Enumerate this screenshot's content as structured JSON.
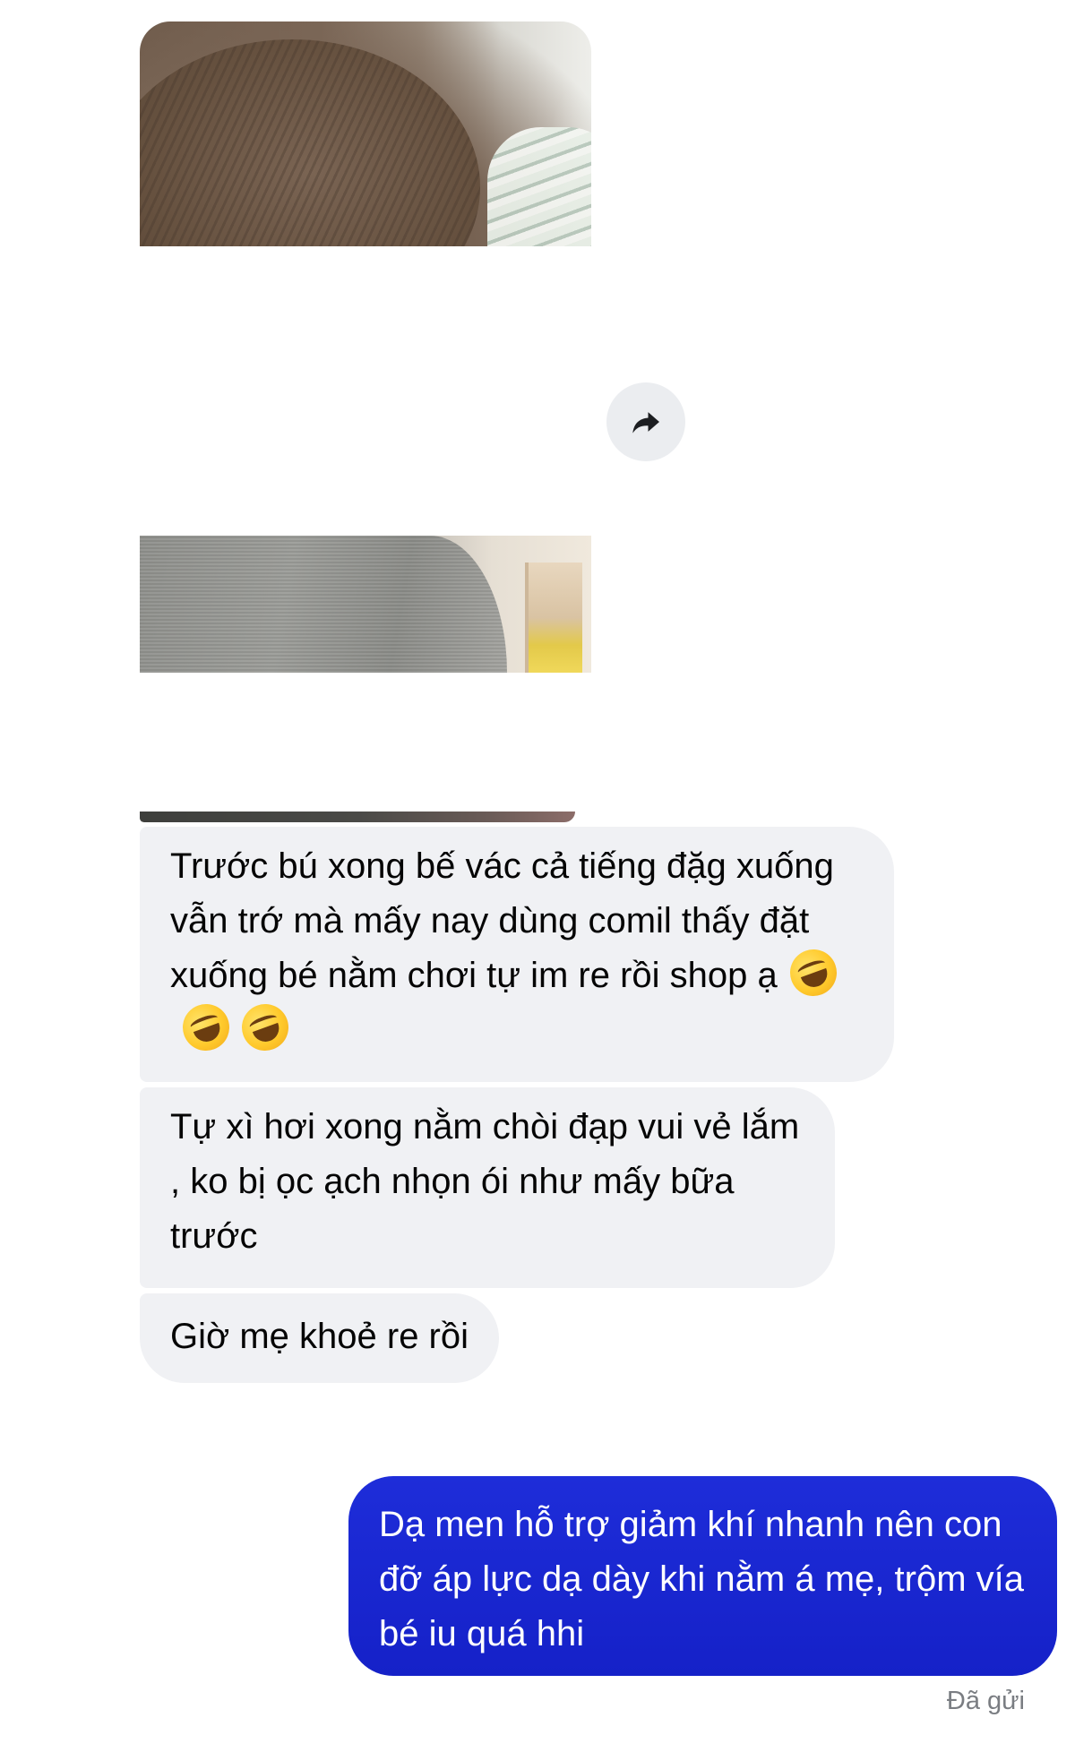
{
  "conversation": {
    "messages": [
      {
        "direction": "incoming",
        "type": "image",
        "name": "photo-1"
      },
      {
        "direction": "incoming",
        "type": "image",
        "name": "photo-2"
      },
      {
        "direction": "incoming",
        "type": "text",
        "text": "Trước bú xong bế vác cả tiếng đặg xuống vẫn trớ mà mấy nay dùng comil thấy đặt xuống bé nằm chơi tự im re rồi shop ạ",
        "emoji": [
          "rolling-on-floor-laughing",
          "rolling-on-floor-laughing",
          "rolling-on-floor-laughing"
        ]
      },
      {
        "direction": "incoming",
        "type": "text",
        "text": "Tự xì hơi xong nằm chòi đạp vui vẻ lắm , ko bị ọc ạch nhọn ói như mấy bữa trước"
      },
      {
        "direction": "incoming",
        "type": "text",
        "text": "Giờ mẹ khoẻ re rồi"
      },
      {
        "direction": "outgoing",
        "type": "text",
        "text": "Dạ men hỗ trợ giảm khí nhanh nên con đỡ áp lực dạ dày khi nằm á mẹ, trộm vía bé iu quá hhi"
      }
    ],
    "status": "Đã gửi"
  },
  "icons": {
    "forward": "share-arrow-icon",
    "emoji": "rolling-on-floor-laughing"
  },
  "colors": {
    "incoming_bubble": "#f0f1f4",
    "outgoing_bubble": "#1a27d1",
    "outgoing_text": "#ffffff",
    "status_text": "#7a7d82"
  }
}
